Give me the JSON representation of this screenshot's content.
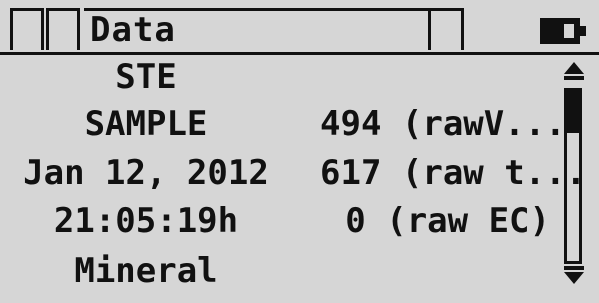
{
  "header": {
    "title": "Data"
  },
  "icons": {
    "battery": "battery-icon",
    "scroll_up": "chevron-up-icon",
    "scroll_down": "chevron-down-icon"
  },
  "rows": [
    {
      "left": "STE",
      "right": ""
    },
    {
      "left": "SAMPLE",
      "right": "494 (rawV..."
    },
    {
      "left": "Jan 12, 2012",
      "right": "617 (raw t..."
    },
    {
      "left": "21:05:19h",
      "right": "0 (raw EC)"
    },
    {
      "left": "Mineral",
      "right": ""
    }
  ],
  "scroll": {
    "position": 0.0
  }
}
